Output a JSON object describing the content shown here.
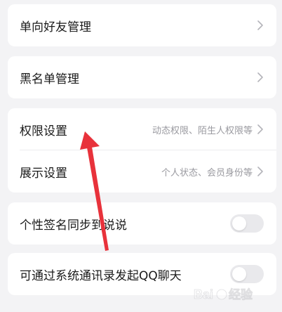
{
  "settings": {
    "one_way_friends": {
      "label": "单向好友管理"
    },
    "blacklist": {
      "label": "黑名单管理"
    },
    "permissions": {
      "label": "权限设置",
      "detail": "动态权限、陌生人权限等"
    },
    "display": {
      "label": "展示设置",
      "detail": "个人状态、会员身份等"
    },
    "signature_sync": {
      "label": "个性签名同步到说说",
      "enabled": false
    },
    "contacts_chat": {
      "label": "可通过系统通讯录发起QQ聊天",
      "enabled": false
    }
  },
  "annotation": {
    "arrow_color": "#e8323b"
  },
  "watermark": {
    "text": "Baidu 经验"
  },
  "colors": {
    "background": "#f3f3f5",
    "card": "#ffffff",
    "label": "#1a1a1a",
    "detail": "#9a9aa0",
    "toggle_off": "#e9e9ec"
  }
}
